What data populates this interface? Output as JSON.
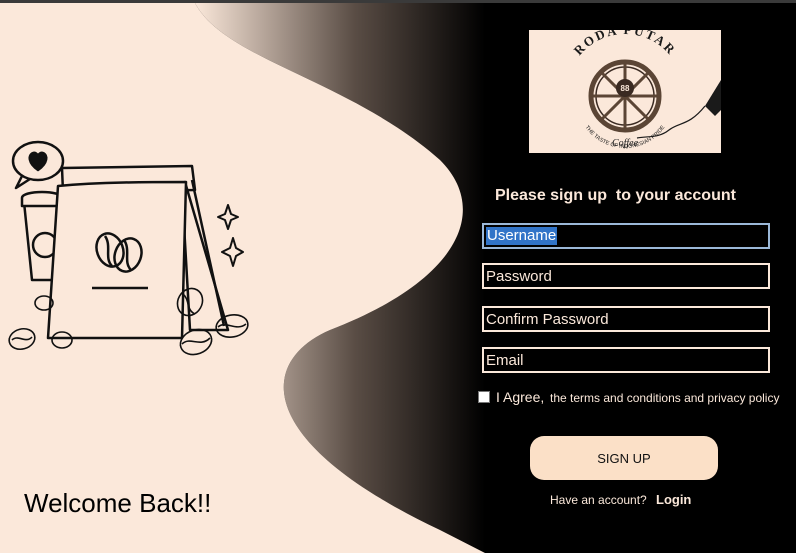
{
  "colors": {
    "cream": "#fbe8da",
    "button": "#fbe0c7",
    "panel": "#000000",
    "selection": "#3174c8"
  },
  "left_panel": {
    "welcome_text": "Welcome Back!!",
    "illustration_icons": [
      "coffee-bag-icon",
      "coffee-bean-icon",
      "coffee-cup-icon",
      "heart-bubble-icon",
      "sparkle-icon"
    ]
  },
  "logo": {
    "brand": "RODA PUTAR",
    "number": "88",
    "tagline": "THE TASTE OF INDONESIAN PRIDE",
    "sub": "Coffee"
  },
  "form": {
    "heading": "Please sign up  to your account",
    "username_value": "Username",
    "password_placeholder": "Password",
    "confirm_placeholder": "Confirm Password",
    "email_placeholder": "Email",
    "agree_label": "I Agree,",
    "terms_text": "the terms and conditions and privacy policy",
    "agree_checked": false,
    "signup_label": "SIGN UP",
    "have_account_text": "Have an account?",
    "login_label": "Login"
  }
}
